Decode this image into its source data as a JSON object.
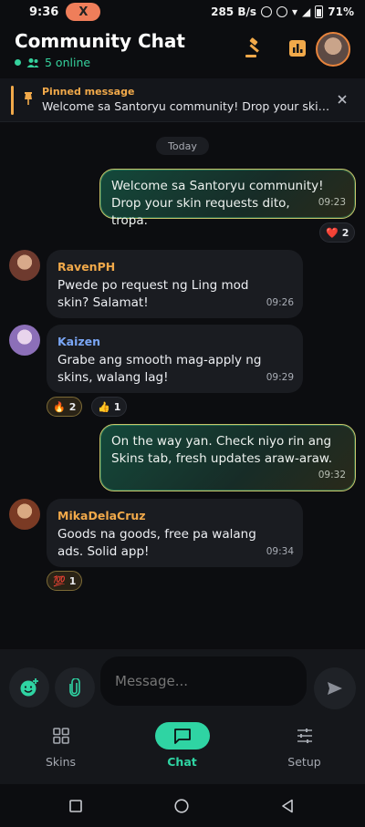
{
  "status_bar": {
    "time": "9:36",
    "pill": "X",
    "net_speed": "285 B/s",
    "battery": "71%"
  },
  "header": {
    "title": "Community Chat",
    "online": "5 online"
  },
  "pinned": {
    "label": "Pinned message",
    "text": "Welcome sa Santoryu community! Drop your skin req..."
  },
  "day_separator": "Today",
  "messages": [
    {
      "text": "Welcome sa Santoryu community! Drop your skin requests dito, tropa.",
      "time": "09:23",
      "reaction": {
        "emoji": "❤️",
        "count": "2"
      }
    },
    {
      "sender": "RavenPH",
      "text": "Pwede po request ng Ling mod skin? Salamat!",
      "time": "09:26"
    },
    {
      "sender": "Kaizen",
      "text": "Grabe ang smooth mag-apply ng skins, walang lag!",
      "time": "09:29",
      "reactions": [
        {
          "emoji": "🔥",
          "count": "2"
        },
        {
          "emoji": "👍",
          "count": "1"
        }
      ]
    },
    {
      "text": "On the way yan. Check niyo rin ang Skins tab, fresh updates araw-araw.",
      "time": "09:32"
    },
    {
      "sender": "MikaDelaCruz",
      "text": "Goods na goods, free pa walang ads. Solid app!",
      "time": "09:34",
      "reaction": {
        "emoji": "💯",
        "count": "1"
      }
    }
  ],
  "composer": {
    "placeholder": "Message..."
  },
  "nav": [
    {
      "label": "Skins"
    },
    {
      "label": "Chat"
    },
    {
      "label": "Setup"
    }
  ],
  "colors": {
    "accent": "#2fd4a3",
    "pinned": "#f1a94a",
    "raven": "#f1a94a",
    "kaizen": "#7aa6f5",
    "mika": "#f1a94a"
  }
}
